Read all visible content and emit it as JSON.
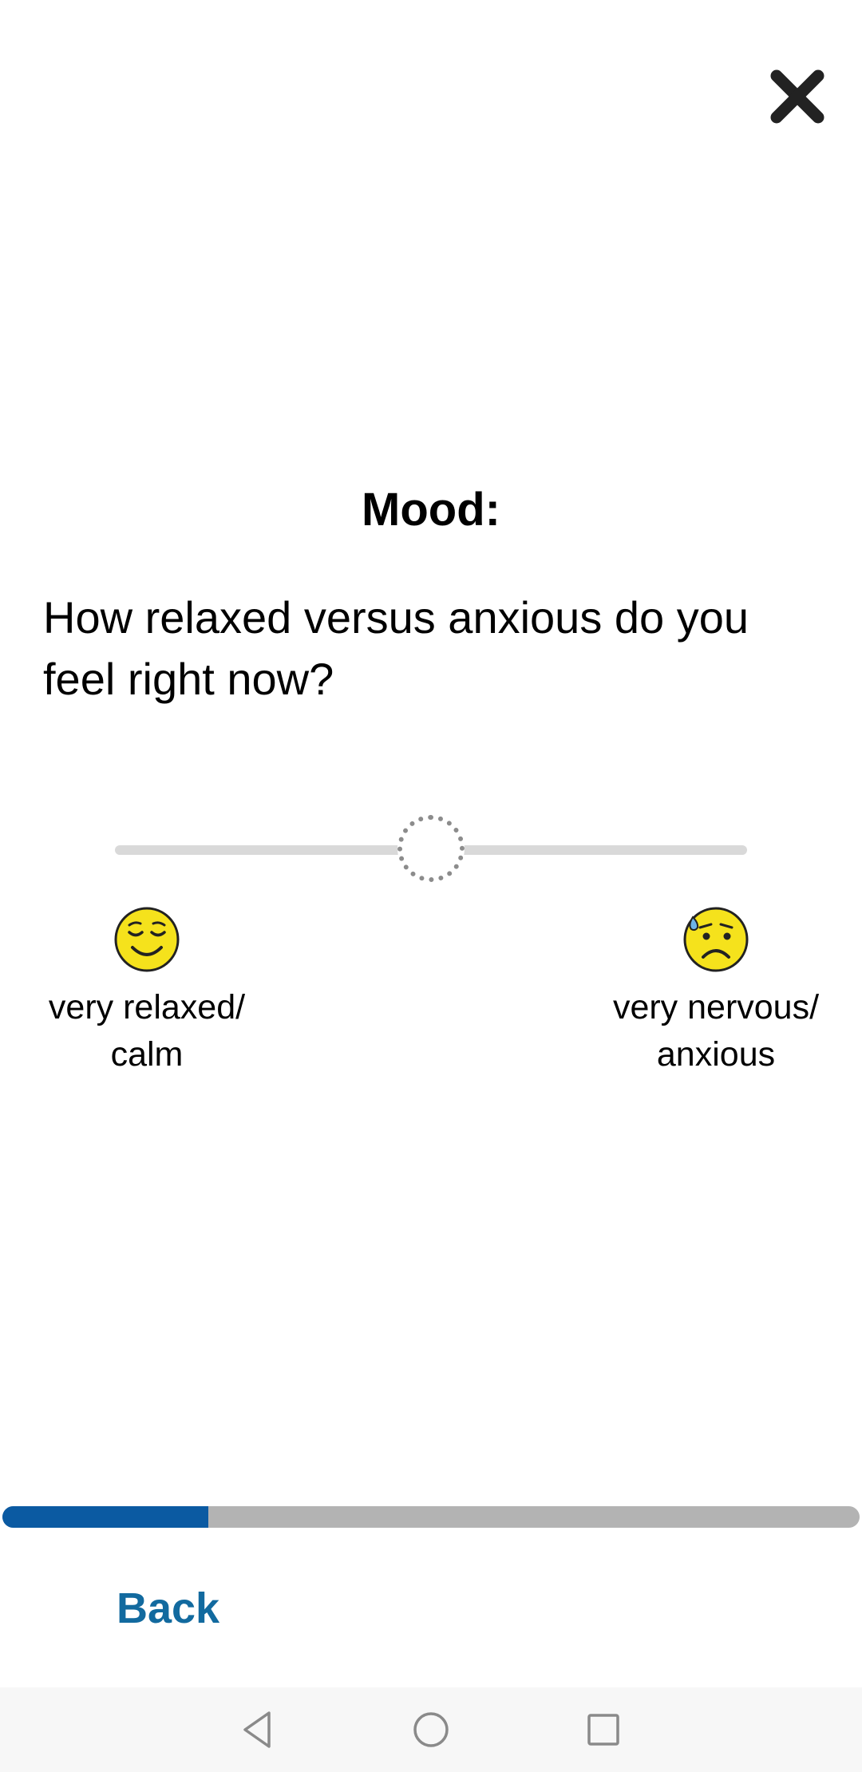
{
  "header": {
    "close_icon": "close-icon"
  },
  "question": {
    "title": "Mood:",
    "text": "How relaxed versus anxious do you feel right now?"
  },
  "slider": {
    "value_fraction": 0.5,
    "left_anchor": {
      "icon": "relieved-face-emoji",
      "label": "very relaxed/ calm"
    },
    "right_anchor": {
      "icon": "anxious-face-with-sweat-emoji",
      "label": "very nervous/ anxious"
    }
  },
  "progress": {
    "fraction": 0.24,
    "fill_color": "#0b5aa2",
    "track_color": "#b3b3b3"
  },
  "footer": {
    "back_label": "Back",
    "back_color": "#126a9f"
  },
  "system_nav": {
    "back_icon": "nav-back-icon",
    "home_icon": "nav-home-icon",
    "recents_icon": "nav-recents-icon"
  }
}
